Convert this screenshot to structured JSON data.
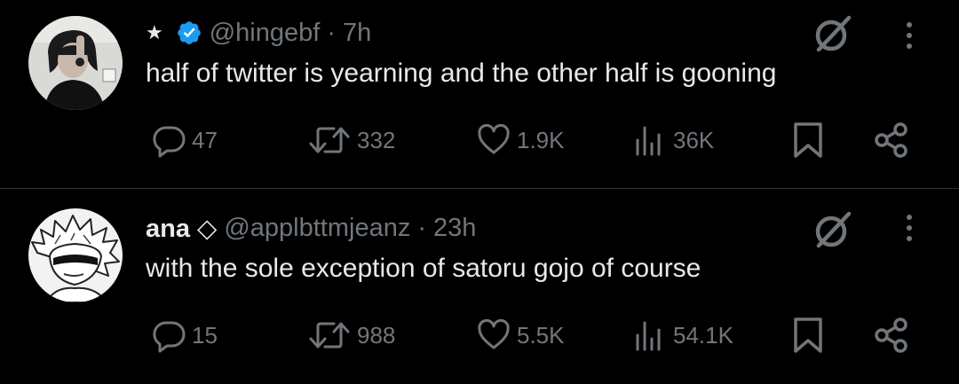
{
  "colors": {
    "background": "#000000",
    "text_primary": "#e7e9ea",
    "text_secondary": "#71767b",
    "verified_badge": "#1d9bf0",
    "divider": "#2f3336"
  },
  "tweets": [
    {
      "avatar_icon": "user-avatar",
      "display_name": "",
      "star": "★",
      "verified": true,
      "verified_icon": "verified-badge-icon",
      "handle": "@hingebf",
      "separator": "·",
      "time": "7h",
      "text": "half of twitter is yearning and the other half is gooning",
      "stats": {
        "replies": "47",
        "retweets": "332",
        "likes": "1.9K",
        "views": "36K"
      }
    },
    {
      "avatar_icon": "anime-character-avatar",
      "display_name": "ana ◇",
      "star": "",
      "verified": false,
      "handle": "@applbttmjeanz",
      "separator": "·",
      "time": "23h",
      "text": "with the sole exception of satoru gojo of course",
      "stats": {
        "replies": "15",
        "retweets": "988",
        "likes": "5.5K",
        "views": "54.1K"
      }
    }
  ]
}
